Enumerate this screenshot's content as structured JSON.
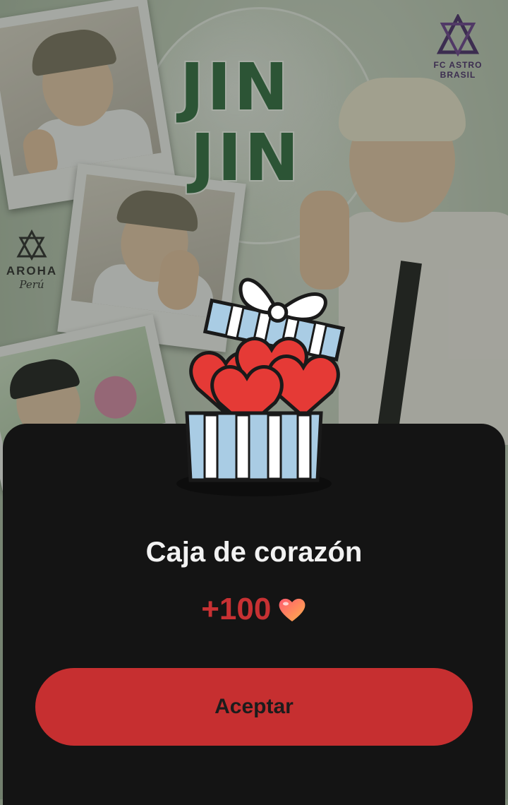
{
  "background": {
    "title_lines": [
      "JIN",
      "JIN"
    ],
    "logo_right": {
      "text": "FC ASTRO BRASIL",
      "icon": "astro-logo-icon"
    },
    "logo_left": {
      "line1": "AROHA",
      "line2": "Perú",
      "icon": "aroha-logo-icon"
    }
  },
  "modal": {
    "title": "Caja de corazón",
    "reward_amount": "+100",
    "reward_icon": "heart-icon",
    "accept_label": "Aceptar",
    "gift_icon": "heart-gift-box-icon"
  },
  "colors": {
    "sheet_bg": "#141414",
    "accent_red": "#c62f30",
    "title_green": "#2f6b3f"
  }
}
